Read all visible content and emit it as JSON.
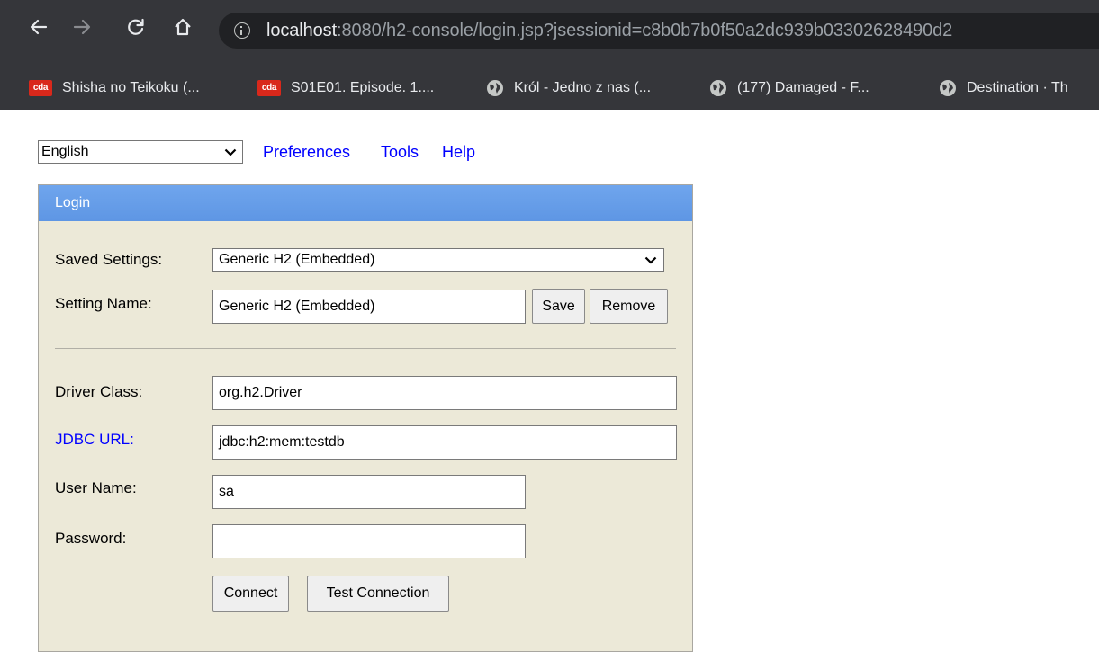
{
  "browser": {
    "url_host": "localhost",
    "url_rest": ":8080/h2-console/login.jsp?jsessionid=c8b0b7b0f50a2dc939b03302628490d2",
    "icons": [
      "back-arrow-icon",
      "forward-arrow-icon",
      "reload-icon",
      "home-icon",
      "info-icon"
    ],
    "bookmarks": [
      {
        "label": "Shisha no Teikoku (...",
        "icon": "cda-favicon-icon",
        "icon_text": "cda"
      },
      {
        "label": "S01E01. Episode. 1....",
        "icon": "cda-favicon-icon",
        "icon_text": "cda"
      },
      {
        "label": "Król - Jedno z nas (...",
        "icon": "globe-icon"
      },
      {
        "label": "(177) Damaged - F...",
        "icon": "globe-icon"
      },
      {
        "label": "Destination · Th",
        "icon": "globe-icon"
      }
    ]
  },
  "top": {
    "language_selected": "English",
    "links": [
      "Preferences",
      "Tools",
      "Help"
    ]
  },
  "login": {
    "header": "Login",
    "saved_settings_label": "Saved Settings:",
    "saved_settings_value": "Generic H2 (Embedded)",
    "setting_name_label": "Setting Name:",
    "setting_name_value": "Generic H2 (Embedded)",
    "save_button": "Save",
    "remove_button": "Remove",
    "driver_class_label": "Driver Class:",
    "driver_class_value": "org.h2.Driver",
    "jdbc_url_label": "JDBC URL:",
    "jdbc_url_value": "jdbc:h2:mem:testdb",
    "user_name_label": "User Name:",
    "user_name_value": "sa",
    "password_label": "Password:",
    "password_value": "",
    "connect_button": "Connect",
    "test_connection_button": "Test Connection"
  },
  "colors": {
    "chrome_bg": "#35363a",
    "omnibox_bg": "#202124",
    "panel_bg": "#ece9d8",
    "header_bg": "#6fa5ed",
    "link_blue": "#0000ff",
    "cda_red": "#d9281b"
  }
}
